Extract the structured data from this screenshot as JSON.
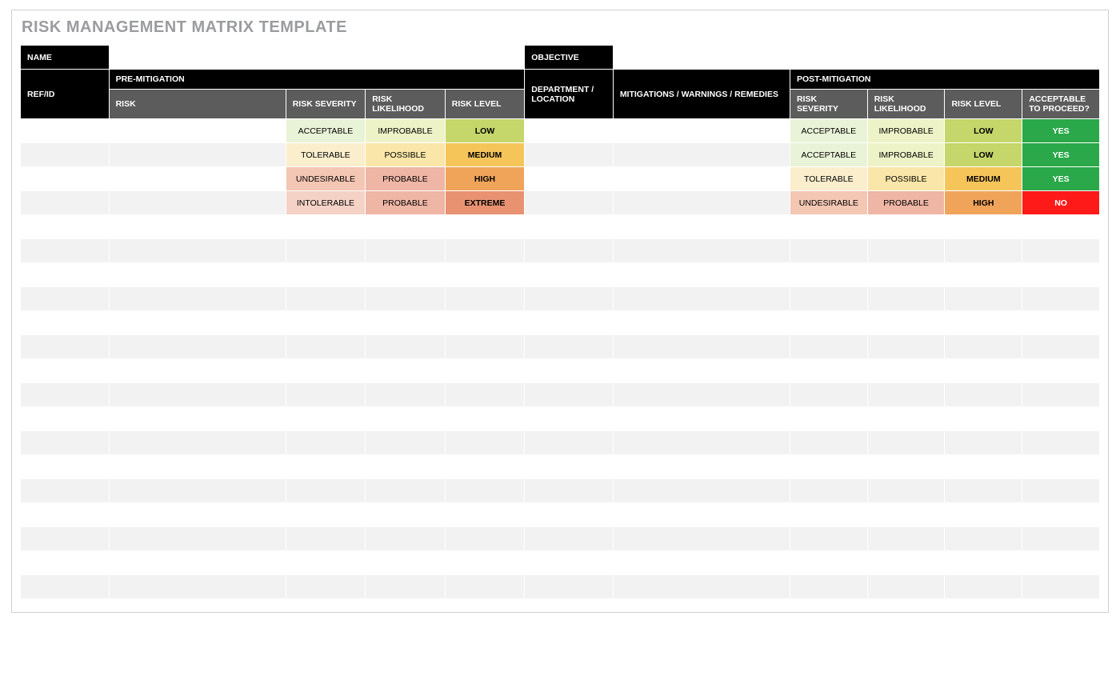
{
  "page_title": "RISK MANAGEMENT MATRIX TEMPLATE",
  "top_fields": {
    "name_label": "NAME",
    "objective_label": "OBJECTIVE"
  },
  "header": {
    "ref_id": "REF/ID",
    "pre_mitigation": "PRE-MITIGATION",
    "department_location": "DEPARTMENT / LOCATION",
    "mitigations": "MITIGATIONS / WARNINGS / REMEDIES",
    "post_mitigation": "POST-MITIGATION",
    "risk": "RISK",
    "risk_severity": "RISK SEVERITY",
    "risk_likelihood": "RISK LIKELIHOOD",
    "risk_level": "RISK LEVEL",
    "acceptable": "ACCEPTABLE TO PROCEED?"
  },
  "values": {
    "severity": {
      "acceptable": "ACCEPTABLE",
      "tolerable": "TOLERABLE",
      "undesirable": "UNDESIRABLE",
      "intolerable": "INTOLERABLE"
    },
    "likelihood": {
      "improbable": "IMPROBABLE",
      "possible": "POSSIBLE",
      "probable": "PROBABLE"
    },
    "level": {
      "low": "LOW",
      "medium": "MEDIUM",
      "high": "HIGH",
      "extreme": "EXTREME"
    },
    "proceed": {
      "yes": "YES",
      "no": "NO"
    }
  },
  "rows": [
    {
      "pre": {
        "sev": "acceptable",
        "lk": "improbable",
        "lvl": "low"
      },
      "post": {
        "sev": "acceptable",
        "lk": "improbable",
        "lvl": "low"
      },
      "proceed": "yes"
    },
    {
      "pre": {
        "sev": "tolerable",
        "lk": "possible",
        "lvl": "medium"
      },
      "post": {
        "sev": "acceptable",
        "lk": "improbable",
        "lvl": "low"
      },
      "proceed": "yes"
    },
    {
      "pre": {
        "sev": "undesirable",
        "lk": "probable",
        "lvl": "high"
      },
      "post": {
        "sev": "tolerable",
        "lk": "possible",
        "lvl": "medium"
      },
      "proceed": "yes"
    },
    {
      "pre": {
        "sev": "intolerable",
        "lk": "probable",
        "lvl": "extreme"
      },
      "post": {
        "sev": "undesirable",
        "lk": "probable",
        "lvl": "high"
      },
      "proceed": "no"
    }
  ],
  "empty_row_count": 16
}
